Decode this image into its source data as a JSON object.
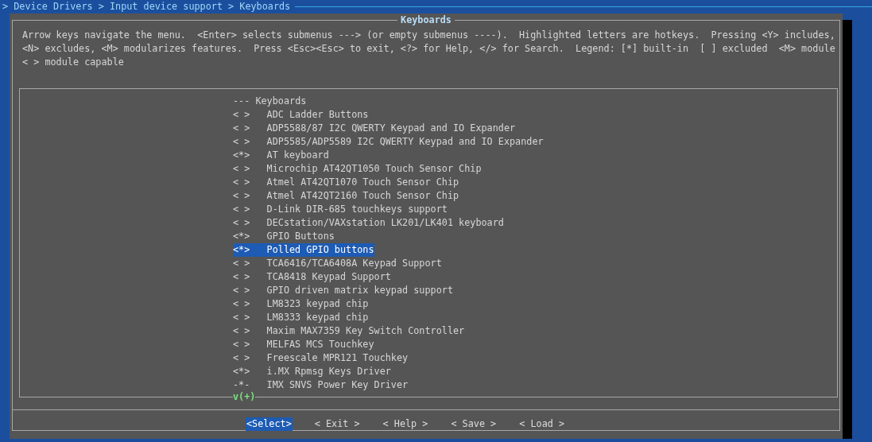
{
  "breadcrumb": "> Device Drivers > Input device support > Keyboards",
  "dialog": {
    "title": "Keyboards",
    "help_lines": [
      "Arrow keys navigate the menu.  <Enter> selects submenus ---> (or empty submenus ----).  Highlighted letters are hotkeys.  Pressing <Y> includes,",
      "<N> excludes, <M> modularizes features.  Press <Esc><Esc> to exit, <?> for Help, </> for Search.  Legend: [*] built-in  [ ] excluded  <M> module",
      "< > module capable"
    ],
    "menu": [
      {
        "kind": "header",
        "label": "--- Keyboards"
      },
      {
        "kind": "option",
        "prefix": "< >",
        "label": "ADC Ladder Buttons",
        "selected": false
      },
      {
        "kind": "option",
        "prefix": "< >",
        "label": "ADP5588/87 I2C QWERTY Keypad and IO Expander",
        "selected": false
      },
      {
        "kind": "option",
        "prefix": "< >",
        "label": "ADP5585/ADP5589 I2C QWERTY Keypad and IO Expander",
        "selected": false
      },
      {
        "kind": "option",
        "prefix": "<*>",
        "label": "AT keyboard",
        "selected": false
      },
      {
        "kind": "option",
        "prefix": "< >",
        "label": "Microchip AT42QT1050 Touch Sensor Chip",
        "selected": false
      },
      {
        "kind": "option",
        "prefix": "< >",
        "label": "Atmel AT42QT1070 Touch Sensor Chip",
        "selected": false
      },
      {
        "kind": "option",
        "prefix": "< >",
        "label": "Atmel AT42QT2160 Touch Sensor Chip",
        "selected": false
      },
      {
        "kind": "option",
        "prefix": "< >",
        "label": "D-Link DIR-685 touchkeys support",
        "selected": false
      },
      {
        "kind": "option",
        "prefix": "< >",
        "label": "DECstation/VAXstation LK201/LK401 keyboard",
        "selected": false
      },
      {
        "kind": "option",
        "prefix": "<*>",
        "label": "GPIO Buttons",
        "selected": false
      },
      {
        "kind": "option",
        "prefix": "<*>",
        "label": "Polled GPIO buttons",
        "selected": true
      },
      {
        "kind": "option",
        "prefix": "< >",
        "label": "TCA6416/TCA6408A Keypad Support",
        "selected": false
      },
      {
        "kind": "option",
        "prefix": "< >",
        "label": "TCA8418 Keypad Support",
        "selected": false
      },
      {
        "kind": "option",
        "prefix": "< >",
        "label": "GPIO driven matrix keypad support",
        "selected": false
      },
      {
        "kind": "option",
        "prefix": "< >",
        "label": "LM8323 keypad chip",
        "selected": false
      },
      {
        "kind": "option",
        "prefix": "< >",
        "label": "LM8333 keypad chip",
        "selected": false
      },
      {
        "kind": "option",
        "prefix": "< >",
        "label": "Maxim MAX7359 Key Switch Controller",
        "selected": false
      },
      {
        "kind": "option",
        "prefix": "< >",
        "label": "MELFAS MCS Touchkey",
        "selected": false
      },
      {
        "kind": "option",
        "prefix": "< >",
        "label": "Freescale MPR121 Touchkey",
        "selected": false
      },
      {
        "kind": "option",
        "prefix": "<*>",
        "label": "i.MX Rpmsg Keys Driver",
        "selected": false
      },
      {
        "kind": "option",
        "prefix": "-*-",
        "label": "IMX SNVS Power Key Driver",
        "selected": false
      }
    ],
    "more_indicator": "v(+)",
    "buttons": [
      {
        "label": "<Select>",
        "selected": true
      },
      {
        "label": "< Exit >",
        "selected": false
      },
      {
        "label": "< Help >",
        "selected": false
      },
      {
        "label": "< Save >",
        "selected": false
      },
      {
        "label": "< Load >",
        "selected": false
      }
    ]
  }
}
